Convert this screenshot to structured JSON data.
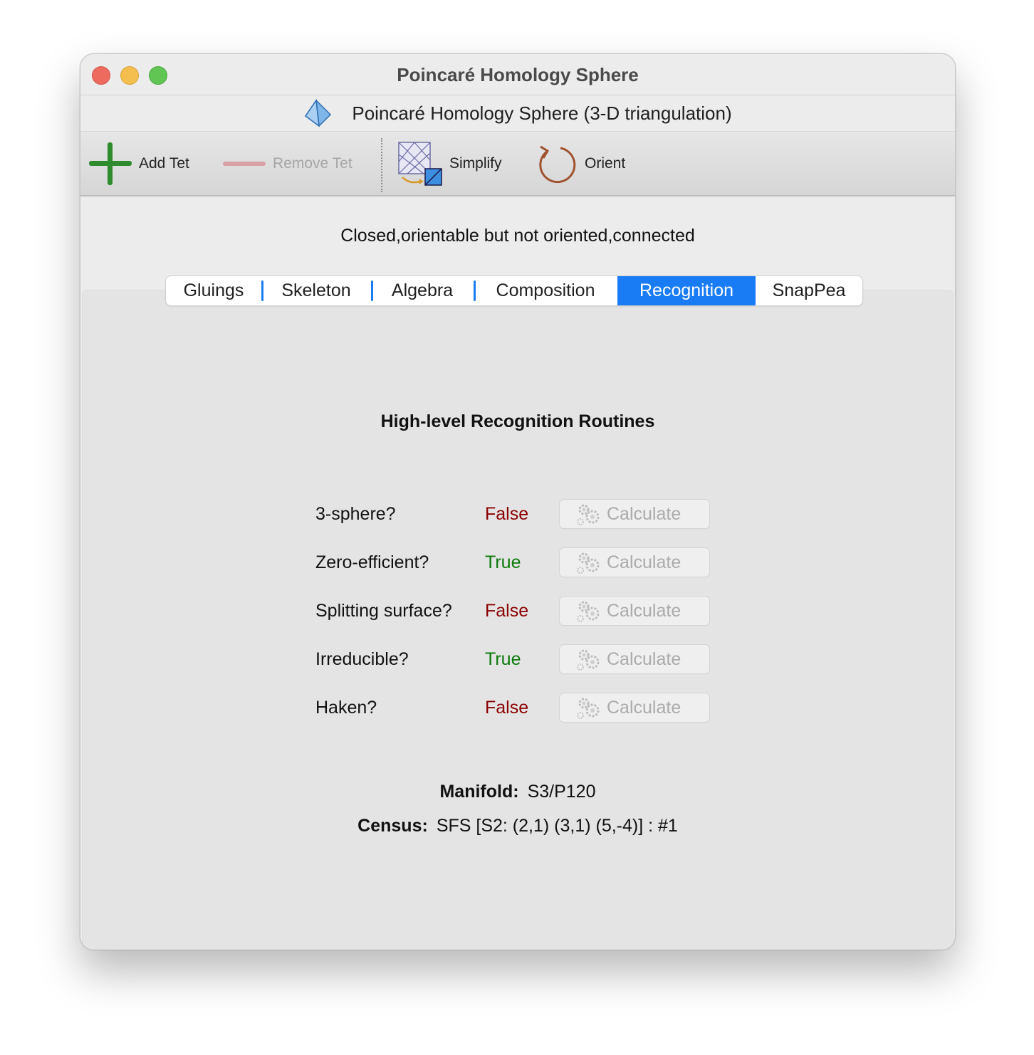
{
  "window": {
    "title": "Poincaré Homology Sphere"
  },
  "subheader": {
    "text": "Poincaré Homology Sphere (3-D triangulation)",
    "icon": "tetrahedron-icon"
  },
  "toolbar": {
    "add_tet": "Add Tet",
    "remove_tet": "Remove Tet",
    "simplify": "Simplify",
    "orient": "Orient"
  },
  "status": "Closed,orientable but not oriented,connected",
  "tabs": [
    {
      "label": "Gluings",
      "selected": false
    },
    {
      "label": "Skeleton",
      "selected": false
    },
    {
      "label": "Algebra",
      "selected": false
    },
    {
      "label": "Composition",
      "selected": false
    },
    {
      "label": "Recognition",
      "selected": true
    },
    {
      "label": "SnapPea",
      "selected": false
    }
  ],
  "recognition": {
    "heading": "High-level Recognition Routines",
    "rows": [
      {
        "label": "3-sphere?",
        "value": "False",
        "button": "Calculate"
      },
      {
        "label": "Zero-efficient?",
        "value": "True",
        "button": "Calculate"
      },
      {
        "label": "Splitting surface?",
        "value": "False",
        "button": "Calculate"
      },
      {
        "label": "Irreducible?",
        "value": "True",
        "button": "Calculate"
      },
      {
        "label": "Haken?",
        "value": "False",
        "button": "Calculate"
      }
    ],
    "manifold_label": "Manifold:",
    "manifold_value": "S3/P120",
    "census_label": "Census:",
    "census_value": "SFS [S2: (2,1) (3,1) (5,-4)] : #1"
  },
  "colors": {
    "accent": "#1a7cf5",
    "false": "#8b0000",
    "true": "#0a7a0a",
    "add_green": "#2e8b2e",
    "remove_red": "#d9a0a6",
    "orient_brown": "#a0522d"
  }
}
